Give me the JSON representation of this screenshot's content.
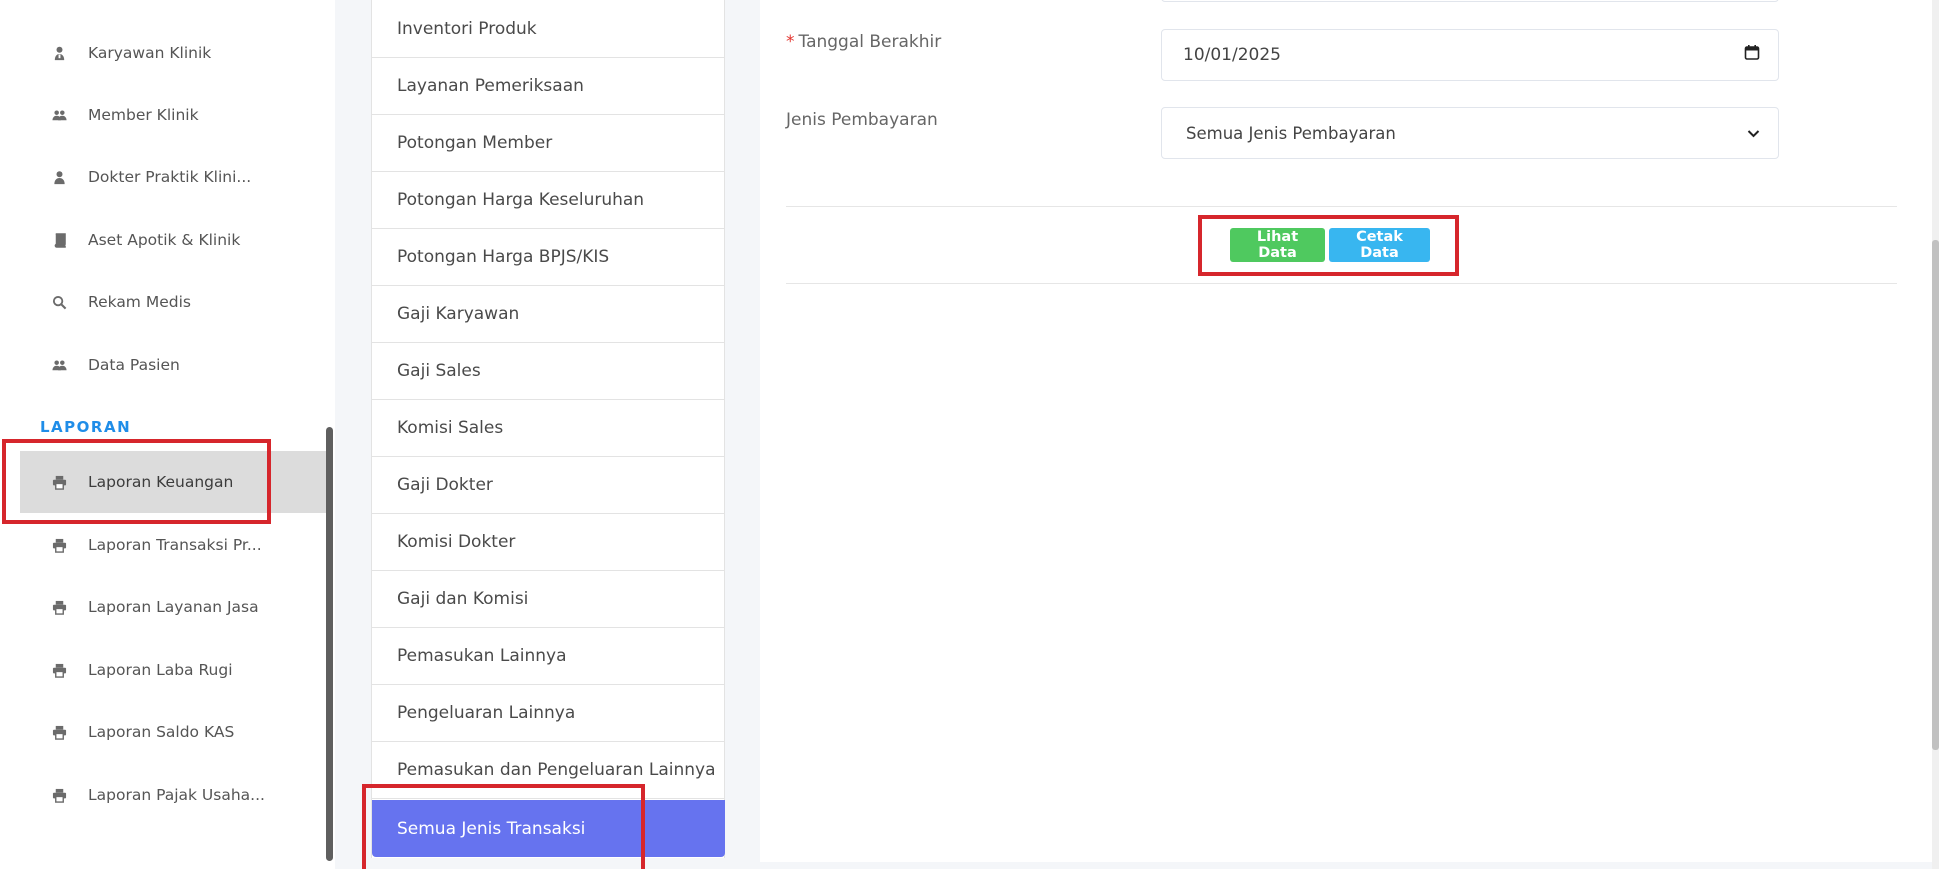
{
  "sidebar": {
    "items": [
      {
        "label": "Karyawan Klinik",
        "icon": "user-tie-icon"
      },
      {
        "label": "Member Klinik",
        "icon": "users-icon"
      },
      {
        "label": "Dokter Praktik Klini...",
        "icon": "user-icon"
      },
      {
        "label": "Aset Apotik & Klinik",
        "icon": "book-icon"
      },
      {
        "label": "Rekam Medis",
        "icon": "search-icon"
      },
      {
        "label": "Data Pasien",
        "icon": "users-icon"
      }
    ],
    "section_heading": "LAPORAN",
    "report_items": [
      {
        "label": "Laporan Keuangan",
        "icon": "print-icon",
        "active": true
      },
      {
        "label": "Laporan Transaksi Pr...",
        "icon": "print-icon"
      },
      {
        "label": "Laporan Layanan Jasa",
        "icon": "print-icon"
      },
      {
        "label": "Laporan Laba Rugi",
        "icon": "print-icon"
      },
      {
        "label": "Laporan Saldo KAS",
        "icon": "print-icon"
      },
      {
        "label": "Laporan Pajak Usaha...",
        "icon": "print-icon"
      }
    ]
  },
  "submenu": {
    "items": [
      "Inventori Produk",
      "Layanan Pemeriksaan",
      "Potongan Member",
      "Potongan Harga Keseluruhan",
      "Potongan Harga BPJS/KIS",
      "Gaji Karyawan",
      "Gaji Sales",
      "Komisi Sales",
      "Gaji Dokter",
      "Komisi Dokter",
      "Gaji dan Komisi",
      "Pemasukan Lainnya",
      "Pengeluaran Lainnya",
      "Pemasukan dan Pengeluaran Lainnya",
      "Semua Jenis Transaksi"
    ],
    "active": "Semua Jenis Transaksi"
  },
  "form": {
    "end_date": {
      "label": "Tanggal Berakhir",
      "required_mark": "*",
      "value": "10/01/2025"
    },
    "payment_type": {
      "label": "Jenis Pembayaran",
      "value": "Semua Jenis Pembayaran"
    },
    "view_button": "Lihat Data",
    "print_button": "Cetak Data"
  },
  "colors": {
    "accent": "#1f8de8",
    "active_submenu": "#6673ef",
    "button_green": "#4fc95f",
    "button_blue": "#38b6f0",
    "highlight_red": "#d6262c"
  }
}
